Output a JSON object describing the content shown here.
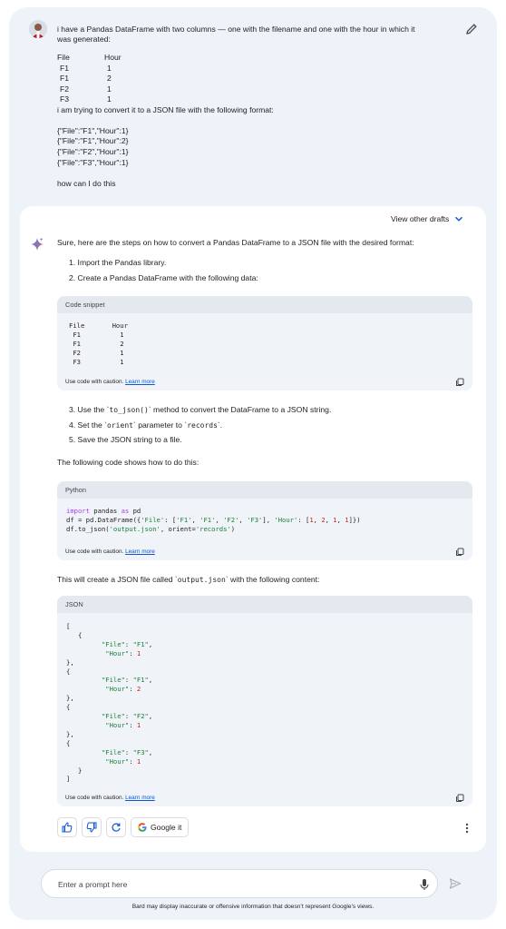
{
  "user": {
    "intro": "i have a Pandas DataFrame with two columns — one with the filename and one with the hour in which it was generated:",
    "table": {
      "headers": [
        "File",
        "Hour"
      ],
      "rows": [
        [
          "F1",
          "1"
        ],
        [
          "F1",
          "2"
        ],
        [
          "F2",
          "1"
        ],
        [
          "F3",
          "1"
        ]
      ]
    },
    "convert_text": "i am trying to convert it to a JSON file with the following format:",
    "json_lines": [
      "{\"File\":\"F1\",\"Hour\":1}",
      "{\"File\":\"F1\",\"Hour\":2}",
      "{\"File\":\"F2\",\"Hour\":1}",
      "{\"File\":\"F3\",\"Hour\":1}"
    ],
    "question": "how can I do this"
  },
  "response": {
    "drafts_label": "View other drafts",
    "intro": "Sure, here are the steps on how to convert a Pandas DataFrame to a JSON file with the desired format:",
    "steps_a": [
      "1. Import the Pandas library.",
      "2. Create a Pandas DataFrame with the following data:"
    ],
    "code1": {
      "title": "Code snippet",
      "code": "File       Hour\n F1          1\n F1          2\n F2          1\n F3          1"
    },
    "step3_pre": "3. Use the `",
    "step3_code": "to_json()",
    "step3_post": "` method to convert the DataFrame to a JSON string.",
    "step4_pre": "4. Set the `",
    "step4_code": "orient",
    "step4_mid": "` parameter to `",
    "step4_code2": "records",
    "step4_post": "`.",
    "step5": "5. Save the JSON string to a file.",
    "following": "The following code shows how to do this:",
    "code2": {
      "title": "Python"
    },
    "will_create_pre": "This will create a JSON file called `",
    "will_create_code": "output.json",
    "will_create_post": "` with the following content:",
    "code3": {
      "title": "JSON"
    },
    "caution": "Use code with caution.",
    "learn_more": "Learn more",
    "google_it": "Google it"
  },
  "input": {
    "placeholder": "Enter a prompt here"
  },
  "disclaimer": "Bard may display inaccurate or offensive information that doesn’t represent Google’s views.",
  "colors": {
    "background": "#eef2f9",
    "link": "#0b57d0",
    "keyword": "#a142f4",
    "string": "#188038",
    "number": "#c5221f"
  }
}
